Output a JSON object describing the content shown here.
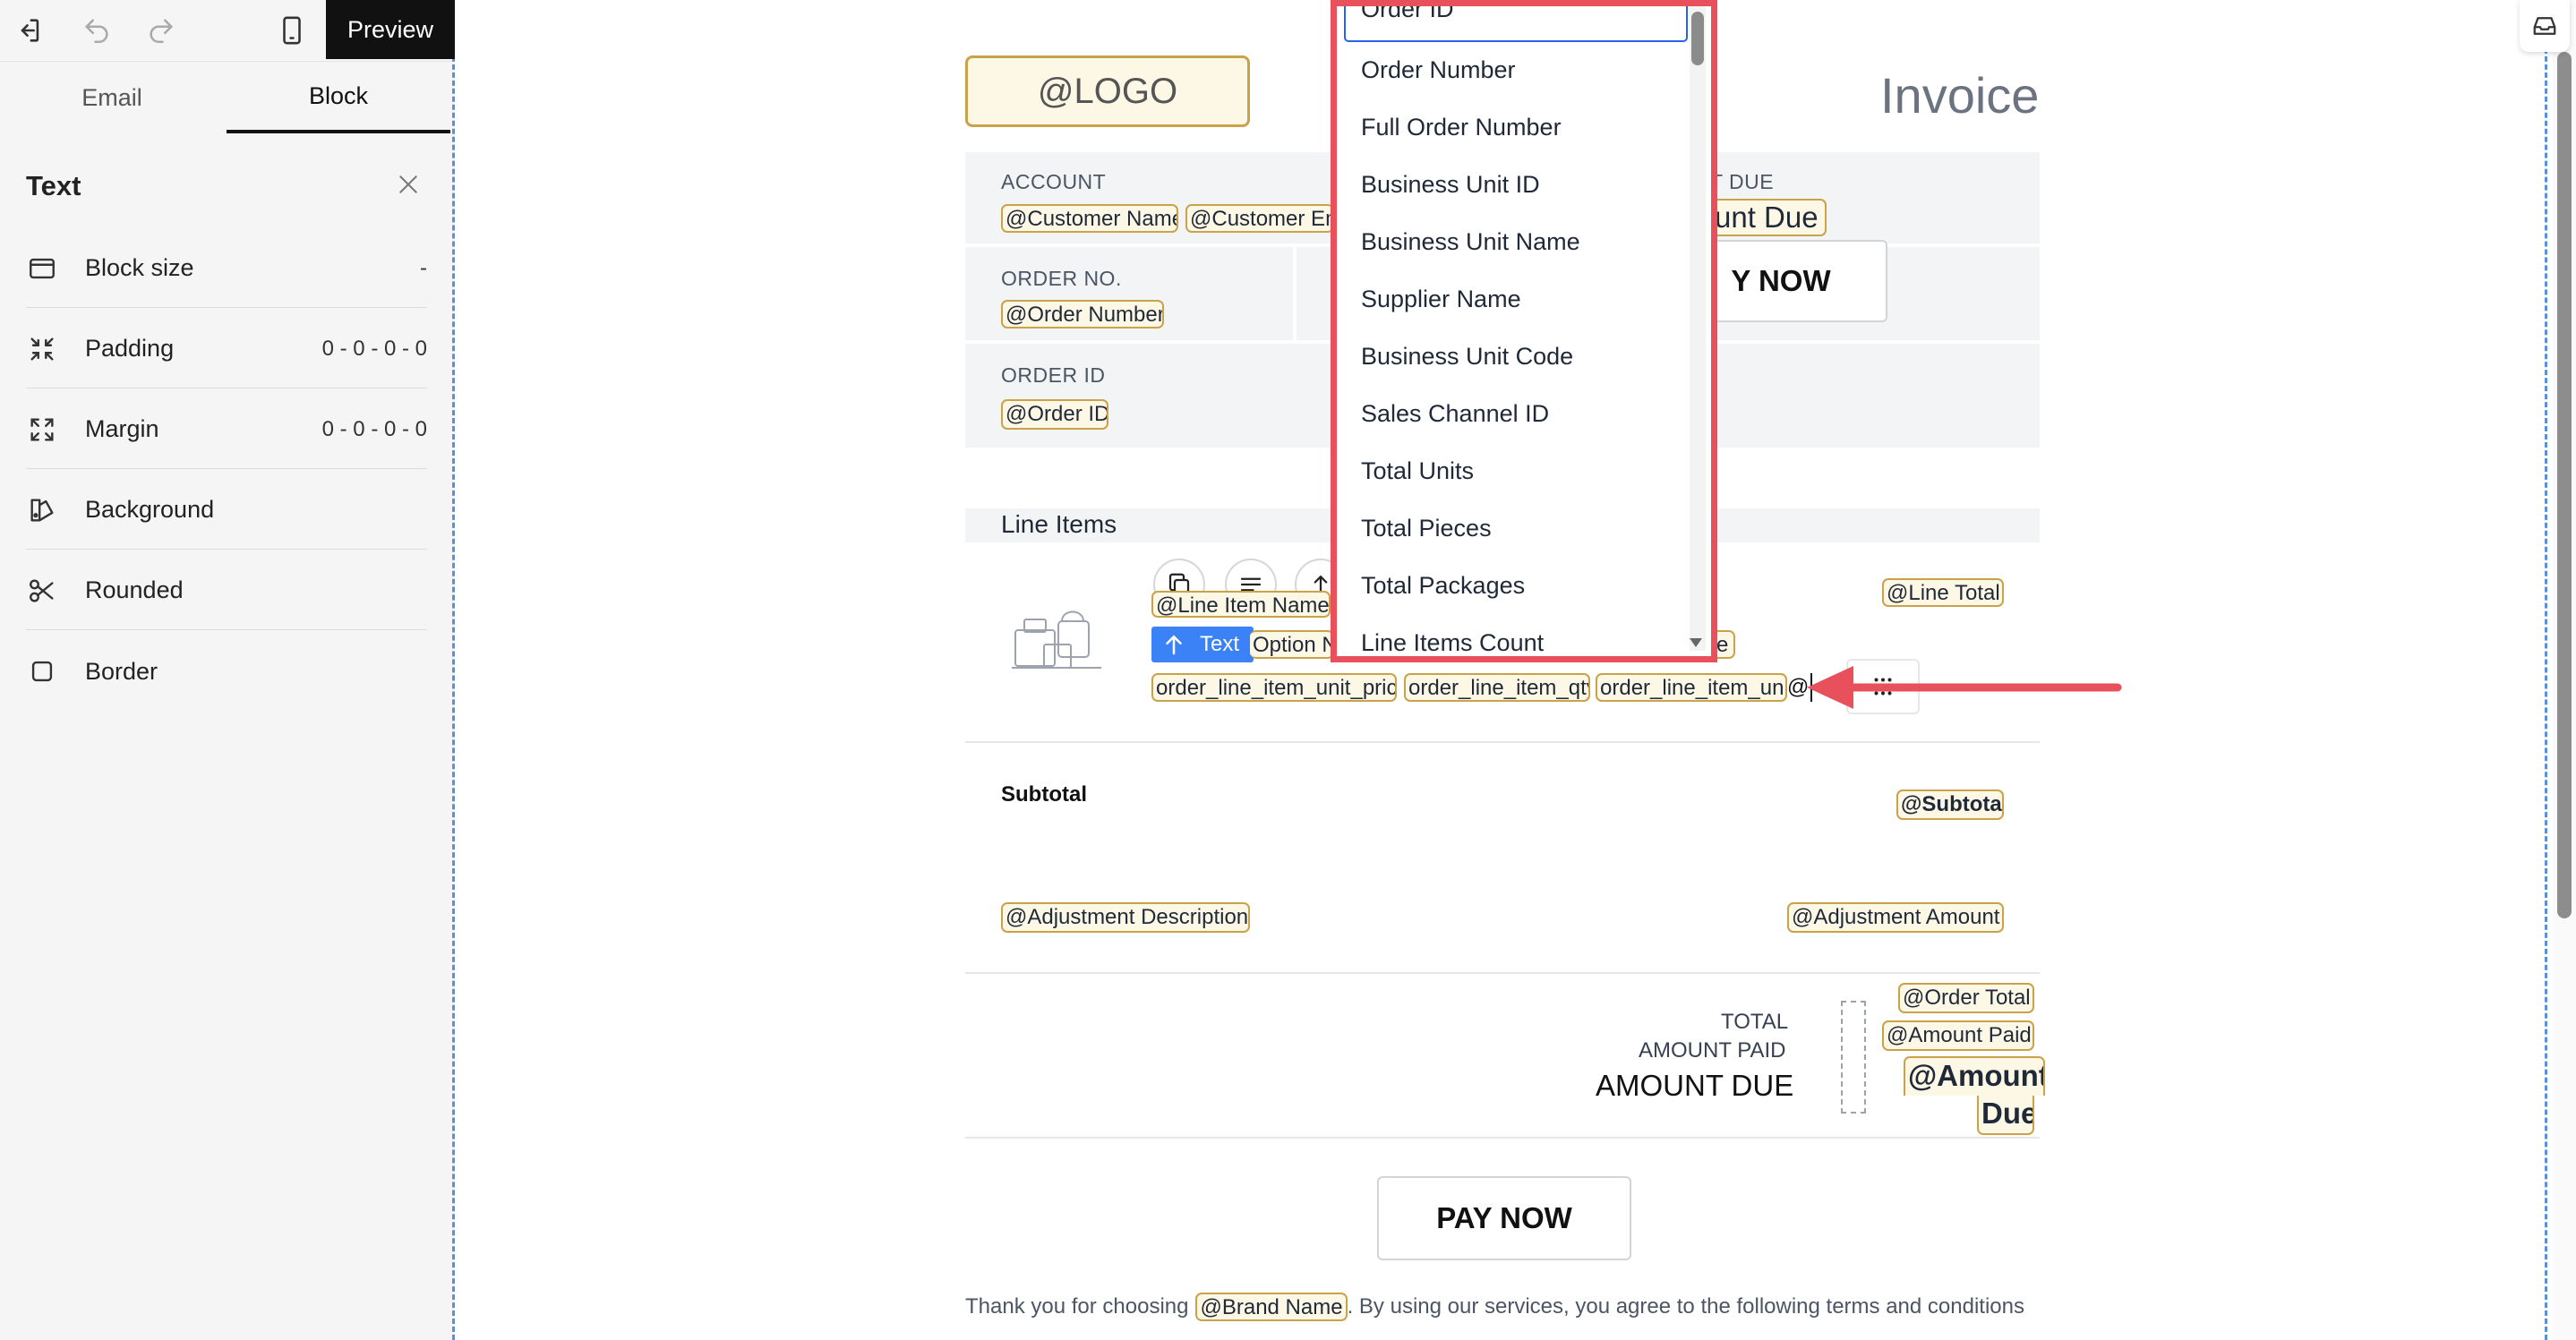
{
  "toolbar": {
    "preview_label": "Preview"
  },
  "tabs": {
    "email": "Email",
    "block": "Block"
  },
  "panel": {
    "title": "Text",
    "rows": [
      {
        "label": "Block size",
        "value": "-",
        "icon": "block-size-icon"
      },
      {
        "label": "Padding",
        "value": "0 - 0 - 0 - 0",
        "icon": "padding-icon"
      },
      {
        "label": "Margin",
        "value": "0 - 0 - 0 - 0",
        "icon": "margin-icon"
      },
      {
        "label": "Background",
        "value": "",
        "icon": "background-icon"
      },
      {
        "label": "Rounded",
        "value": "",
        "icon": "scissors-icon"
      },
      {
        "label": "Border",
        "value": "",
        "icon": "border-icon"
      }
    ]
  },
  "invoice": {
    "logo": "@LOGO",
    "title": "Invoice",
    "account_label": "ACCOUNT",
    "customer_name": "@Customer Name",
    "customer_email": "@Customer Em",
    "order_no_label": "ORDER NO.",
    "order_number": "@Order Number",
    "order_id_label": "ORDER ID",
    "order_id": "@Order ID",
    "amount_due_label": "T DUE",
    "amount_due_chip": "unt Due",
    "pay_now_top": "Y NOW",
    "line_items_label": "Line Items",
    "line_item_name": "@Line Item Name",
    "line_total": "@Line Total",
    "text_tag": "Text",
    "option_name": "Option N",
    "option_tail": "e",
    "unit_price": "order_line_item_unit_price",
    "qty": "order_line_item_qty",
    "unit": "order_line_item_unit",
    "typed_at": "@",
    "subtotal_label": "Subtotal",
    "subtotal": "@Subtotal",
    "adjustment_description": "@Adjustment Description",
    "adjustment_amount": "@Adjustment Amount",
    "total_label": "TOTAL",
    "amount_paid_label": "AMOUNT PAID",
    "amount_due_big_label": "AMOUNT DUE",
    "order_total": "@Order Total",
    "amount_paid": "@Amount Paid",
    "amount_due_line1": "@Amount",
    "amount_due_line2": "Due",
    "pay_now_bottom": "PAY NOW",
    "footer_prefix": "Thank you for choosing",
    "brand_name": "@Brand Name",
    "footer_suffix": ". By using our services, you agree to the following terms and conditions"
  },
  "dropdown": {
    "items": [
      "Order ID",
      "Order Number",
      "Full Order Number",
      "Business Unit ID",
      "Business Unit Name",
      "Supplier Name",
      "Business Unit Code",
      "Sales Channel ID",
      "Total Units",
      "Total Pieces",
      "Total Packages",
      "Line Items Count"
    ]
  },
  "colors": {
    "accent_red": "#e8505b",
    "chip_border": "#c9a24a",
    "chip_bg": "#fdf8e6",
    "text_tag_blue": "#3b82f6",
    "dashed_blue": "#5b8fd8"
  }
}
